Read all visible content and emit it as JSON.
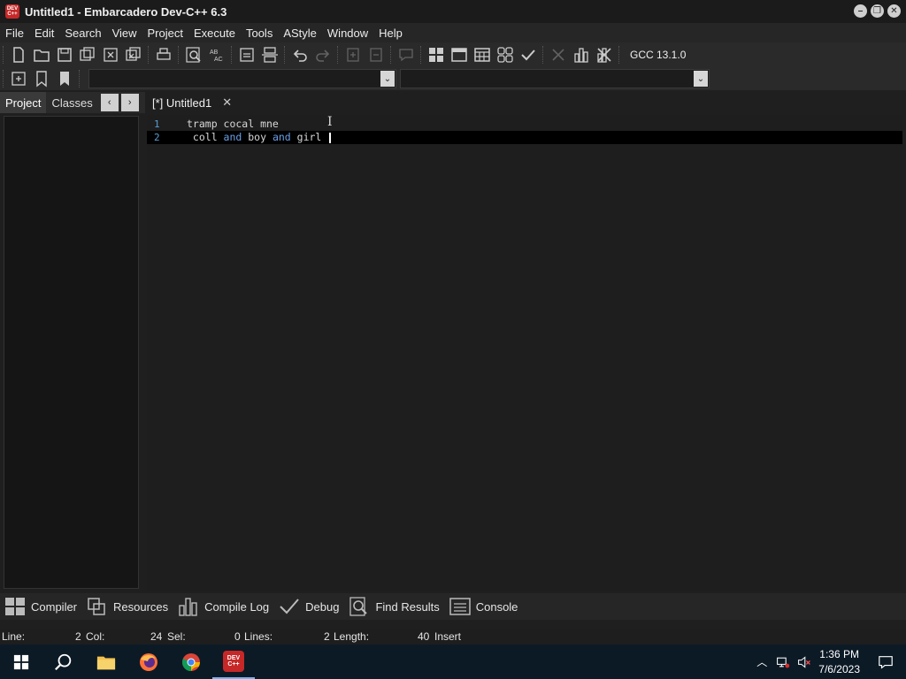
{
  "window": {
    "title": "Untitled1 - Embarcadero Dev-C++ 6.3",
    "app_icon_text": "DEV C++"
  },
  "menu": [
    "File",
    "Edit",
    "Search",
    "View",
    "Project",
    "Execute",
    "Tools",
    "AStyle",
    "Window",
    "Help"
  ],
  "toolbar": {
    "compiler": "GCC 13.1.0"
  },
  "left_panel": {
    "tabs": [
      "Project",
      "Classes"
    ],
    "prev": "‹",
    "next": "›"
  },
  "editor": {
    "tab_label": "[*] Untitled1",
    "tab_close": "✕",
    "lines": [
      {
        "number": "1",
        "text": "tramp cocal mne"
      },
      {
        "number": "2",
        "text": " coll and boy and girl "
      }
    ]
  },
  "bottom_tabs": [
    "Compiler",
    "Resources",
    "Compile Log",
    "Debug",
    "Find Results",
    "Console"
  ],
  "status": {
    "line_label": "Line:",
    "line_value": "2",
    "col_label": "Col:",
    "col_value": "24",
    "sel_label": "Sel:",
    "sel_value": "0",
    "lines_label": "Lines:",
    "lines_value": "2",
    "length_label": "Length:",
    "length_value": "40",
    "mode": "Insert"
  },
  "taskbar": {
    "time": "1:36 PM",
    "date": "7/6/2023",
    "devcpp_icon_text": "DEV C++"
  },
  "colors": {
    "keyword": "#6aa0e6",
    "line_number": "#5a9fd4",
    "background": "#1e1e1e"
  }
}
